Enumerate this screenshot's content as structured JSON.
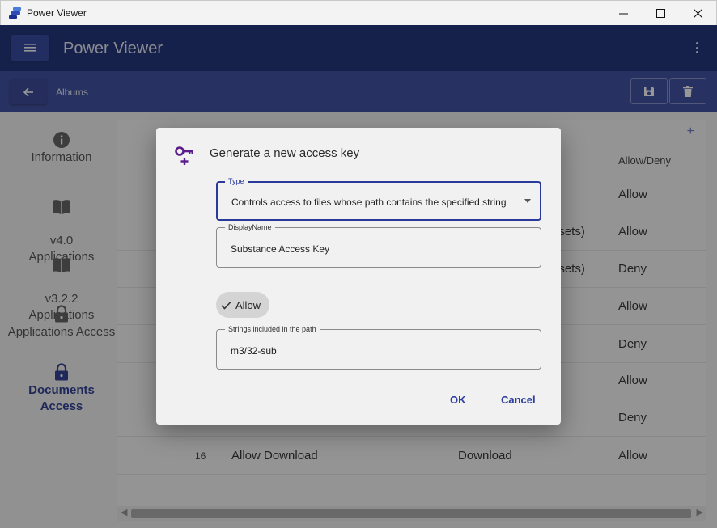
{
  "window": {
    "title": "Power Viewer",
    "controls": {
      "minimize": "—",
      "maximize": "☐",
      "close": "✕"
    }
  },
  "appbar": {
    "title": "Power Viewer",
    "menu_icon": "hamburger-icon",
    "more_icon": "kebab-menu-icon"
  },
  "subbar": {
    "back_icon": "arrow-left-icon",
    "breadcrumb": "Albums",
    "actions": [
      {
        "name": "save",
        "icon": "floppy-disk-icon"
      },
      {
        "name": "delete",
        "icon": "trash-icon"
      }
    ]
  },
  "sidebar": {
    "items": [
      {
        "label": "Information",
        "icon": "info-icon"
      },
      {
        "label": "v4.0\nApplications",
        "icon": "book-icon"
      },
      {
        "label": "v3.2.2\nApplications",
        "icon": "book-icon"
      },
      {
        "label": "Applications Access",
        "icon": "lock-icon"
      },
      {
        "label": "Documents Access",
        "icon": "lock-icon",
        "active": true
      }
    ]
  },
  "table": {
    "add_icon": "plus-icon",
    "header_allow": "Allow/Deny",
    "rows": [
      {
        "num": "",
        "name": "",
        "access": "",
        "extra": "",
        "allow": "Allow"
      },
      {
        "num": "",
        "name": "",
        "access": "",
        "extra": "asets)",
        "allow": "Allow"
      },
      {
        "num": "",
        "name": "",
        "access": "",
        "extra": "asets)",
        "allow": "Deny"
      },
      {
        "num": "",
        "name": "",
        "access": "",
        "extra": "",
        "allow": "Allow"
      },
      {
        "num": "",
        "name": "",
        "access": "",
        "extra": "",
        "allow": "Deny"
      },
      {
        "num": "",
        "name": "",
        "access": "",
        "extra": "",
        "allow": "Allow"
      },
      {
        "num": "",
        "name": "",
        "access": "",
        "extra": "",
        "allow": "Deny"
      },
      {
        "num": "16",
        "name": "Allow Download",
        "access": "Download",
        "extra": "",
        "allow": "Allow"
      }
    ]
  },
  "dialog": {
    "icon": "key-plus-icon",
    "title": "Generate a new access key",
    "type": {
      "label": "Type",
      "value": "Controls access to files whose path contains the specified string"
    },
    "display_name": {
      "label": "DisplayName",
      "value": "Substance Access Key"
    },
    "allow_chip": {
      "label": "Allow",
      "icon": "check-icon"
    },
    "path": {
      "label": "Strings included in the path",
      "value": "m3/32-sub"
    },
    "ok_label": "OK",
    "cancel_label": "Cancel"
  },
  "colors": {
    "appbar": "#0c2070",
    "subbar": "#2d3f9c",
    "accent": "#2a3a9a",
    "key_icon": "#5b1b8c"
  }
}
